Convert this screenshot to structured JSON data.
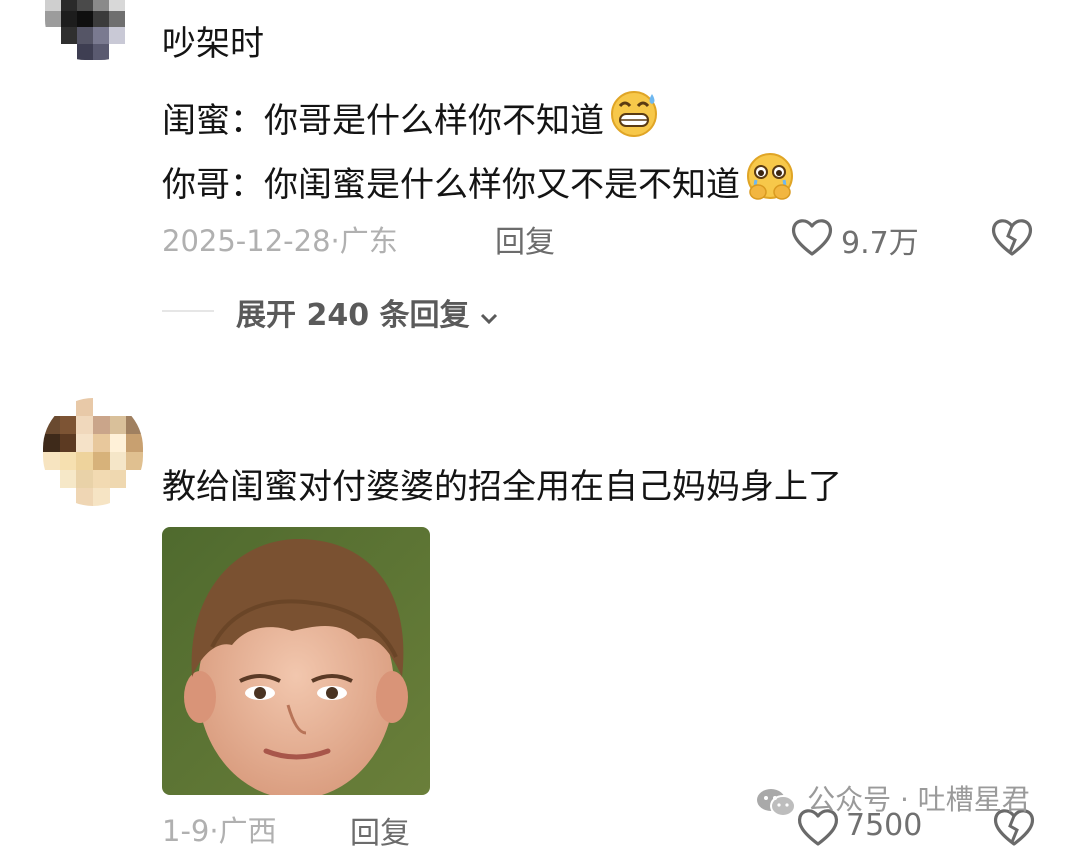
{
  "comment1": {
    "lines": [
      "吵架时",
      "闺蜜：你哥是什么样你不知道",
      "你哥：你闺蜜是什么样你又不是不知道"
    ],
    "emojis": [
      "grinning-sweat-emoji",
      "holding-back-tears-emoji"
    ],
    "meta": "2025-12-28·广东",
    "reply_label": "回复",
    "like_count": "9.7万",
    "expand_label": "展开 240 条回复"
  },
  "comment2": {
    "text": "教给闺蜜对付婆婆的招全用在自己妈妈身上了",
    "meta": "1-9·广西",
    "reply_label": "回复",
    "like_count": "7500"
  },
  "watermark": "公众号 · 吐槽星君",
  "icons": {
    "like": "heart-outline-icon",
    "dislike": "broken-heart-icon",
    "expand": "chevron-down-icon",
    "watermark": "wechat-icon"
  },
  "colors": {
    "text": "#141414",
    "meta": "#b0b0b0",
    "secondary": "#6c6c6c"
  }
}
